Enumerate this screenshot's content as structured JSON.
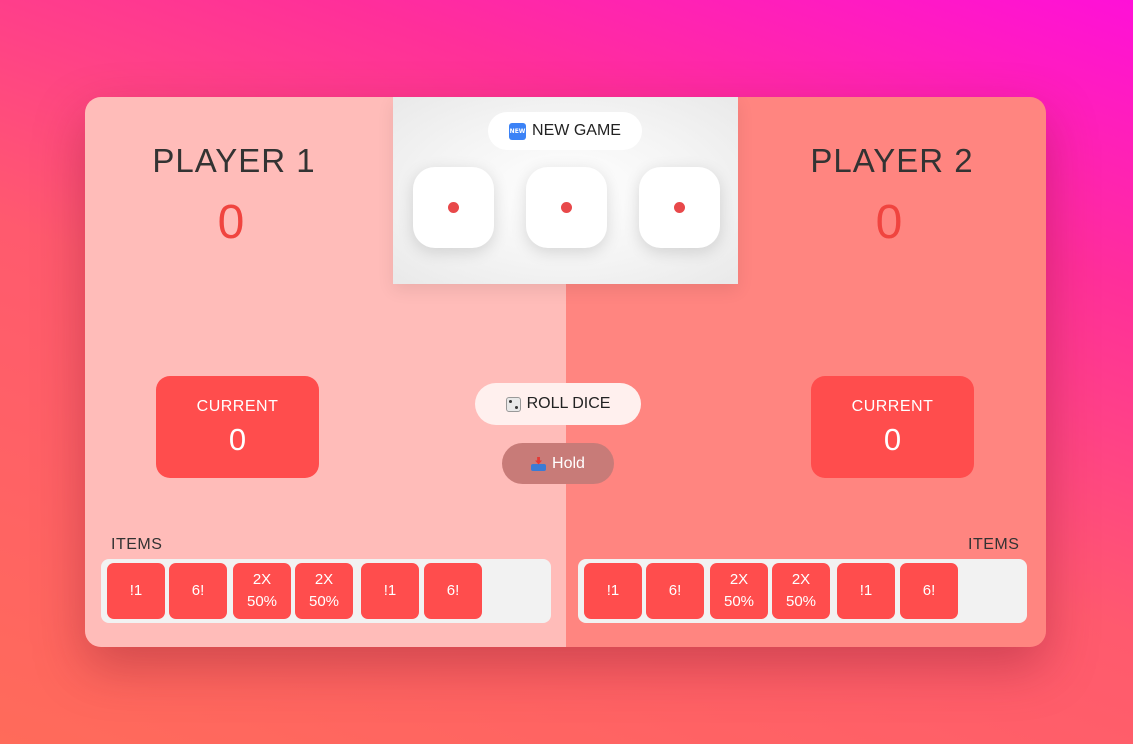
{
  "player1": {
    "name": "PLAYER 1",
    "score": "0",
    "current_label": "CURRENT",
    "current_value": "0"
  },
  "player2": {
    "name": "PLAYER 2",
    "score": "0",
    "current_label": "CURRENT",
    "current_value": "0"
  },
  "controls": {
    "new_game": {
      "icon": "new-badge-icon",
      "label": "NEW GAME"
    },
    "roll_dice": {
      "icon": "dice-icon",
      "label": "ROLL DICE"
    },
    "hold": {
      "icon": "inbox-tray-icon",
      "label": "Hold"
    }
  },
  "dice": [
    {
      "face": 1
    },
    {
      "face": 1
    },
    {
      "face": 1
    }
  ],
  "items_label": "ITEMS",
  "items": [
    {
      "line1": "!1",
      "line2": ""
    },
    {
      "line1": "6!",
      "line2": ""
    },
    {
      "line1": "2X",
      "line2": "50%"
    },
    {
      "line1": "2X",
      "line2": "50%"
    },
    {
      "line1": "!1",
      "line2": ""
    },
    {
      "line1": "6!",
      "line2": ""
    }
  ],
  "colors": {
    "accent": "#ff4d4d",
    "score": "#f0443f",
    "left_panel": "#ffbcb9",
    "right_panel": "#ff8580",
    "pip": "#e8484a"
  }
}
